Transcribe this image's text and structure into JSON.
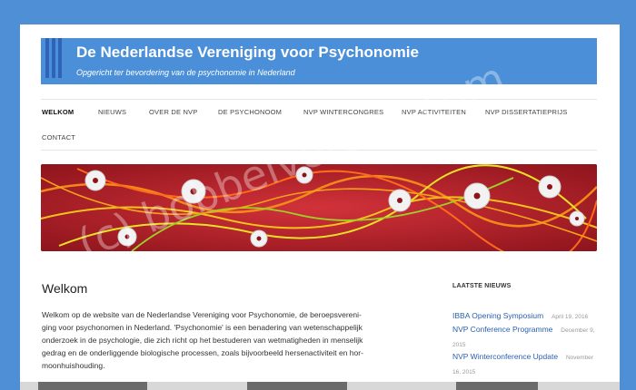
{
  "header": {
    "title": "De Nederlandse Vereniging voor Psychonomie",
    "subtitle": "Opgericht ter bevordering van de psychonomie in Nederland"
  },
  "nav": {
    "items": [
      {
        "label": "WELKOM",
        "active": true
      },
      {
        "label": "NIEUWS"
      },
      {
        "label": "OVER DE NVP"
      },
      {
        "label": "DE PSYCHONOOM"
      },
      {
        "label": "NVP WINTERCONGRES"
      },
      {
        "label": "NVP ACTIVITEITEN"
      },
      {
        "label": "NVP DISSERTATIEPRIJS"
      },
      {
        "label": "CONTACT"
      }
    ]
  },
  "main": {
    "title": "Welkom",
    "lines": [
      "Welkom op de website van de Nederlandse Vereniging voor Psychonomie, de beroepsvereni-",
      "ging voor psychonomen in Nederland. 'Psychonomie' is een benadering van wetenschappelijk",
      "onderzoek in de psychologie, die zich richt op het bestuderen van wetmatigheden in menselijk",
      "gedrag en de onderliggende biologische processen, zoals bijvoorbeeld hersenactiviteit en hor-",
      "moonhuishouding."
    ]
  },
  "sidebar": {
    "title": "LAATSTE NIEUWS",
    "news": [
      {
        "title": "IBBA Opening Symposium",
        "date": "April 19, 2016"
      },
      {
        "title": "NVP Conference Programme",
        "date": "December 9, 2015"
      },
      {
        "title": "NVP Winterconference Update",
        "date": "November 16, 2015"
      }
    ]
  },
  "watermark": "(c) bobbelverbos.com",
  "colors": {
    "background": "#4f8fd6",
    "banner": "#4b8fd8",
    "link": "#2a5fb0"
  }
}
